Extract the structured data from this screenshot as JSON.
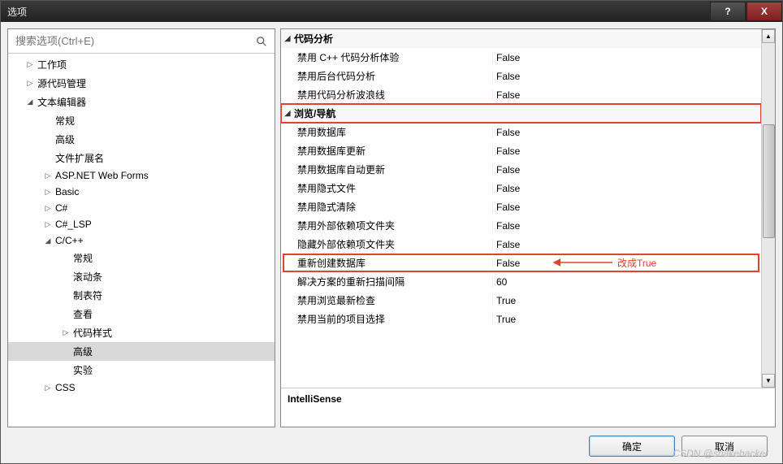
{
  "window": {
    "title": "选项",
    "help": "?",
    "close": "X"
  },
  "search": {
    "placeholder": "搜索选项(Ctrl+E)"
  },
  "tree": [
    {
      "label": "工作项",
      "indent": 0,
      "arrow": "▷"
    },
    {
      "label": "源代码管理",
      "indent": 0,
      "arrow": "▷"
    },
    {
      "label": "文本编辑器",
      "indent": 0,
      "arrow": "◢"
    },
    {
      "label": "常规",
      "indent": 1,
      "arrow": ""
    },
    {
      "label": "高级",
      "indent": 1,
      "arrow": ""
    },
    {
      "label": "文件扩展名",
      "indent": 1,
      "arrow": ""
    },
    {
      "label": "ASP.NET Web Forms",
      "indent": 1,
      "arrow": "▷"
    },
    {
      "label": "Basic",
      "indent": 1,
      "arrow": "▷"
    },
    {
      "label": "C#",
      "indent": 1,
      "arrow": "▷"
    },
    {
      "label": "C#_LSP",
      "indent": 1,
      "arrow": "▷"
    },
    {
      "label": "C/C++",
      "indent": 1,
      "arrow": "◢"
    },
    {
      "label": "常规",
      "indent": 2,
      "arrow": ""
    },
    {
      "label": "滚动条",
      "indent": 2,
      "arrow": ""
    },
    {
      "label": "制表符",
      "indent": 2,
      "arrow": ""
    },
    {
      "label": "查看",
      "indent": 2,
      "arrow": ""
    },
    {
      "label": "代码样式",
      "indent": 2,
      "arrow": "▷"
    },
    {
      "label": "高级",
      "indent": 2,
      "arrow": "",
      "selected": true
    },
    {
      "label": "实验",
      "indent": 2,
      "arrow": ""
    },
    {
      "label": "CSS",
      "indent": 1,
      "arrow": "▷"
    }
  ],
  "grid": {
    "categories": [
      {
        "name": "代码分析",
        "boxed": false,
        "props": [
          {
            "name": "禁用 C++ 代码分析体验",
            "value": "False"
          },
          {
            "name": "禁用后台代码分析",
            "value": "False"
          },
          {
            "name": "禁用代码分析波浪线",
            "value": "False"
          }
        ]
      },
      {
        "name": "浏览/导航",
        "boxed": true,
        "props": [
          {
            "name": "禁用数据库",
            "value": "False"
          },
          {
            "name": "禁用数据库更新",
            "value": "False"
          },
          {
            "name": "禁用数据库自动更新",
            "value": "False"
          },
          {
            "name": "禁用隐式文件",
            "value": "False"
          },
          {
            "name": "禁用隐式清除",
            "value": "False"
          },
          {
            "name": "禁用外部依赖项文件夹",
            "value": "False"
          },
          {
            "name": "隐藏外部依赖项文件夹",
            "value": "False"
          },
          {
            "name": "重新创建数据库",
            "value": "False",
            "boxed": true
          },
          {
            "name": "解决方案的重新扫描间隔",
            "value": "60"
          },
          {
            "name": "禁用浏览最新检查",
            "value": "True"
          },
          {
            "name": "禁用当前的项目选择",
            "value": "True"
          }
        ]
      }
    ]
  },
  "annotation": {
    "text": "改成True"
  },
  "description": {
    "title": "IntelliSense"
  },
  "buttons": {
    "ok": "确定",
    "cancel": "取消"
  },
  "watermark": "CSDN @snakehacker"
}
